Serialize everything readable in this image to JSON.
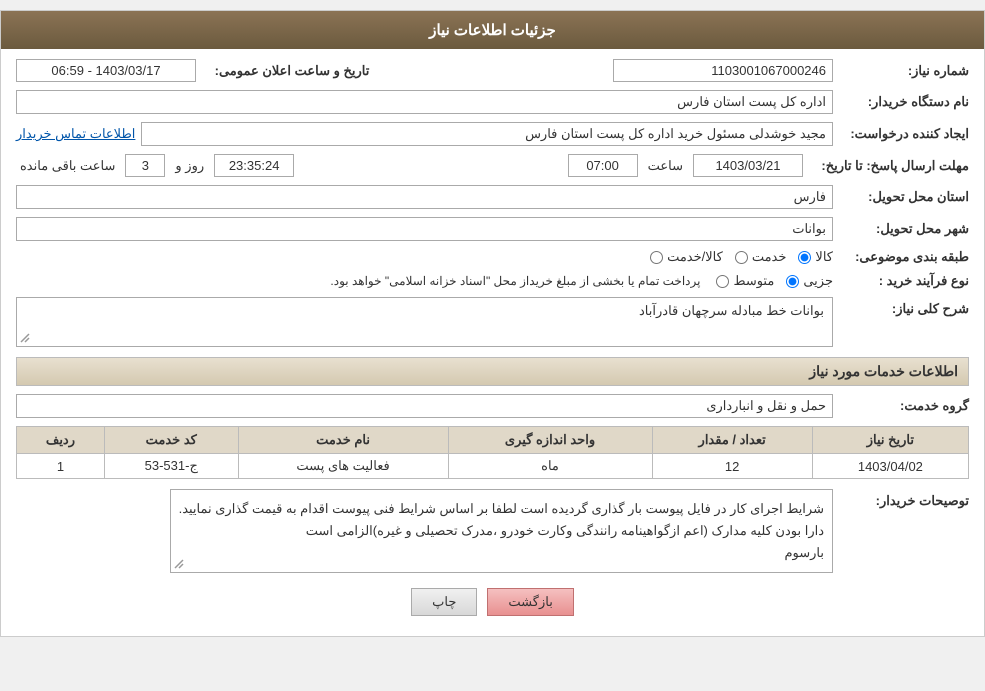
{
  "header": {
    "title": "جزئیات اطلاعات نیاز"
  },
  "form": {
    "need_number_label": "شماره نیاز:",
    "need_number_value": "1103001067000246",
    "announce_date_label": "تاریخ و ساعت اعلان عمومی:",
    "announce_date_value": "1403/03/17 - 06:59",
    "buyer_org_label": "نام دستگاه خریدار:",
    "buyer_org_value": "اداره کل پست استان فارس",
    "creator_label": "ایجاد کننده درخواست:",
    "creator_value": "مجید خوشدلی مسئول خرید اداره کل پست استان فارس",
    "contact_link": "اطلاعات تماس خریدار",
    "deadline_label": "مهلت ارسال پاسخ: تا تاریخ:",
    "deadline_date": "1403/03/21",
    "deadline_time_label": "ساعت",
    "deadline_time": "07:00",
    "deadline_day_label": "روز و",
    "deadline_days": "3",
    "deadline_remain_label": "ساعت باقی مانده",
    "deadline_remain": "23:35:24",
    "province_label": "استان محل تحویل:",
    "province_value": "فارس",
    "city_label": "شهر محل تحویل:",
    "city_value": "بوانات",
    "category_label": "طبقه بندی موضوعی:",
    "radio_kala": "کالا",
    "radio_khadamat": "خدمت",
    "radio_kala_khadamat": "کالا/خدمت",
    "purchase_type_label": "نوع فرآیند خرید :",
    "radio_jozvi": "جزیی",
    "radio_motevaset": "متوسط",
    "purchase_note": "پرداخت تمام یا بخشی از مبلغ خریداز محل \"اسناد خزانه اسلامی\" خواهد بود.",
    "description_label": "شرح کلی نیاز:",
    "description_value": "بوانات خط مبادله سرچهان قادرآباد",
    "services_section_title": "اطلاعات خدمات مورد نیاز",
    "service_group_label": "گروه خدمت:",
    "service_group_value": "حمل و نقل و انبارداری",
    "table_headers": {
      "row_num": "ردیف",
      "service_code": "کد خدمت",
      "service_name": "نام خدمت",
      "unit": "واحد اندازه گیری",
      "quantity": "تعداد / مقدار",
      "date": "تاریخ نیاز"
    },
    "table_rows": [
      {
        "row_num": "1",
        "service_code": "ج-531-53",
        "service_name": "فعالیت های پست",
        "unit": "ماه",
        "quantity": "12",
        "date": "1403/04/02"
      }
    ],
    "buyer_desc_label": "توصیحات خریدار:",
    "buyer_desc_value": "شرایط اجرای کار در فایل پیوست بار گذاری گردیده است لطفا بر اساس شرایط فنی پیوست اقدام به قیمت گذاری نمایید.\nدارا بودن کلیه مدارک (اعم ازگواهینامه رانندگی وکارت خودرو ،مدرک تحصیلی و غیره)الزامی است\nبارسوم",
    "btn_back": "بازگشت",
    "btn_print": "چاپ"
  }
}
